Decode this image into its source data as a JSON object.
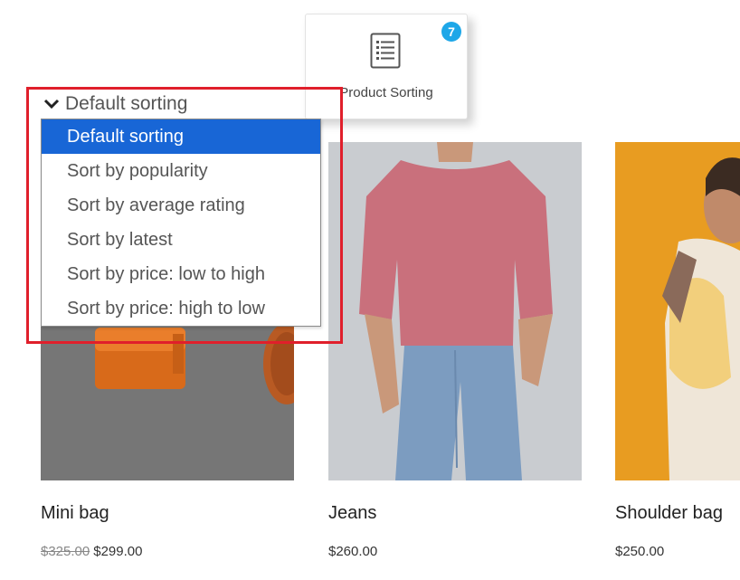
{
  "widget": {
    "label": "Product Sorting",
    "badge": "7",
    "icon": "list-icon"
  },
  "sorting": {
    "current": "Default sorting",
    "options": [
      "Default sorting",
      "Sort by popularity",
      "Sort by average rating",
      "Sort by latest",
      "Sort by price: low to high",
      "Sort by price: high to low"
    ],
    "selected_index": 0,
    "highlight_color": "#e01f2b",
    "selected_color": "#1866d6"
  },
  "products": [
    {
      "title": "Mini bag",
      "old_price": "$325.00",
      "price": "$299.00"
    },
    {
      "title": "Jeans",
      "price": "$260.00"
    },
    {
      "title": "Shoulder bag",
      "price": "$250.00"
    }
  ]
}
